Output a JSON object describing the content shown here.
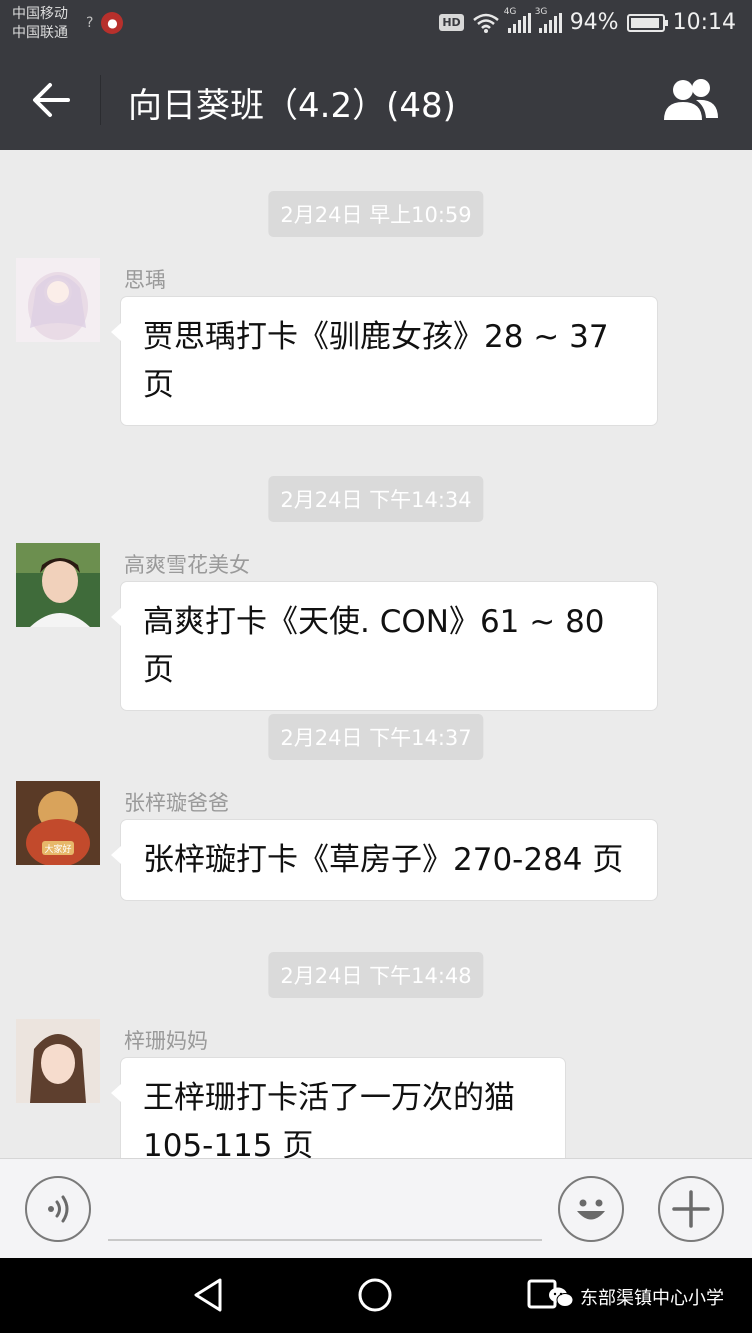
{
  "status_bar": {
    "carrier1": "中国移动",
    "carrier2": "中国联通",
    "unknown_wifi_glyph": "?",
    "hd": "HD",
    "net1": "4G",
    "net2": "3G",
    "battery_text": "94%",
    "battery_level": 0.94,
    "time": "10:14"
  },
  "title_bar": {
    "title": "向日葵班（4.2）(48)",
    "back_icon": "arrow-left-icon",
    "group_icon": "group-members-icon"
  },
  "messages": [
    {
      "timestamp": "2月24日 早上10:59",
      "sender": "思瑀",
      "text_line1": "贾思瑀打卡《驯鹿女孩》28 ~ 37",
      "text_line2": "页"
    },
    {
      "timestamp": "2月24日 下午14:34",
      "sender": "高爽雪花美女",
      "text_line1": "高爽打卡《天使. CON》61 ~ 80 页"
    },
    {
      "timestamp": "2月24日 下午14:37",
      "sender": "张梓璇爸爸",
      "text_line1": "张梓璇打卡《草房子》270-284 页",
      "avatar_caption": "大家好"
    },
    {
      "timestamp": "2月24日 下午14:48",
      "sender": "梓珊妈妈",
      "text_line1": "王梓珊打卡活了一万次的猫",
      "text_line2": "105-115 页"
    }
  ],
  "input_bar": {
    "voice_icon": "voice-icon",
    "emoji_icon": "emoji-icon",
    "plus_icon": "plus-icon"
  },
  "nav_bar": {
    "watermark": "东部渠镇中心小学"
  },
  "colors": {
    "header_bg": "#393a3f",
    "chat_bg": "#ebebeb",
    "timestamp_bg": "#dadada"
  }
}
